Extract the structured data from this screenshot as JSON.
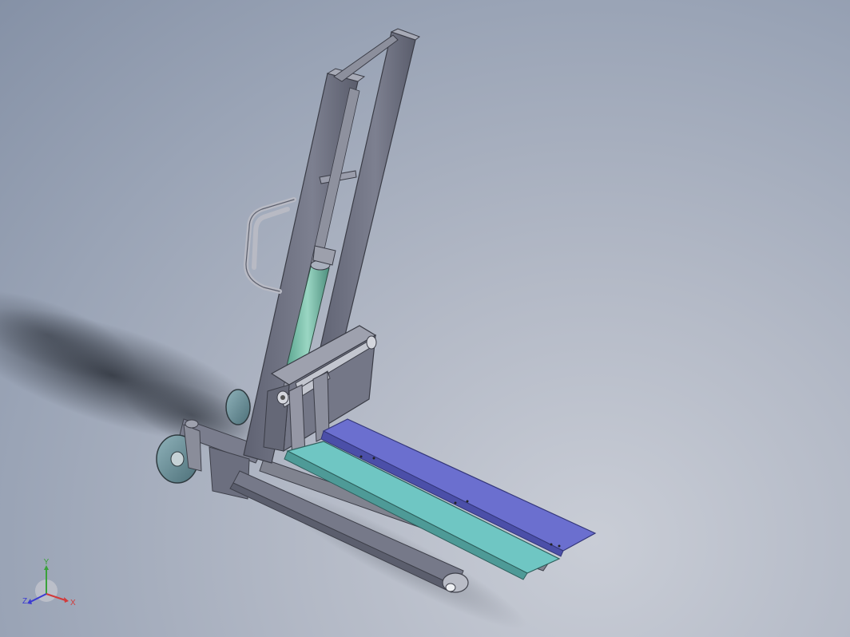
{
  "viewport": {
    "background_top": "#8591a6",
    "background_bottom": "#c9cdd6"
  },
  "model": {
    "frame_color": "#6f7283",
    "frame_light": "#9a9dad",
    "cylinder_color": "#7fc1ad",
    "fork_left_color": "#6fc6c3",
    "fork_right_color": "#6b6fcf",
    "wheel_color": "#6a8f98"
  },
  "triad": {
    "x_label": "X",
    "y_label": "Y",
    "z_label": "Z",
    "x_color": "#d23a3a",
    "y_color": "#3aa13a",
    "z_color": "#3a3ad2"
  }
}
